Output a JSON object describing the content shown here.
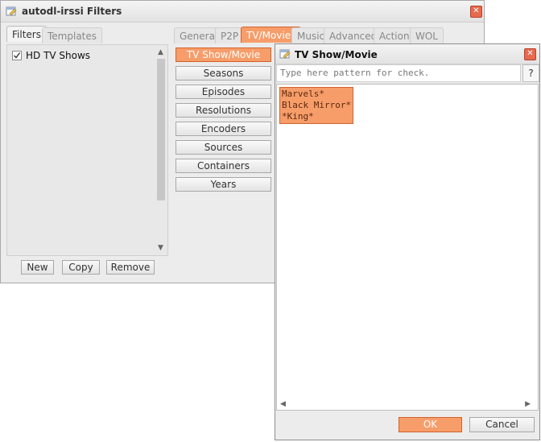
{
  "main_window": {
    "title": "autodl-irssi Filters",
    "close_glyph": "✕",
    "left_tabs": [
      "Filters",
      "Templates"
    ],
    "filters": [
      {
        "label": "HD TV Shows",
        "checked": true
      }
    ],
    "buttons": {
      "new": "New",
      "copy": "Copy",
      "remove": "Remove"
    },
    "right_tabs": [
      "General",
      "P2P",
      "TV/Movies",
      "Music",
      "Advanced",
      "Action",
      "WOL"
    ],
    "active_right_tab": "TV/Movies",
    "section_buttons": [
      "TV Show/Movie",
      "Seasons",
      "Episodes",
      "Resolutions",
      "Encoders",
      "Sources",
      "Containers",
      "Years"
    ],
    "active_section": "TV Show/Movie"
  },
  "dialog": {
    "title": "TV Show/Movie",
    "close_glyph": "✕",
    "pattern_placeholder": "Type here pattern for check.",
    "help_label": "?",
    "text_content": "Marvels*\nBlack Mirror*\n*King*",
    "ok_label": "OK",
    "cancel_label": "Cancel"
  },
  "colors": {
    "accent": "#f79d6a",
    "accent_border": "#d1622c",
    "close": "#e66b4e"
  },
  "icons": [
    "window-icon",
    "close-icon",
    "checkmark-icon",
    "scroll-up-icon",
    "scroll-down-icon",
    "scroll-left-icon",
    "scroll-right-icon",
    "dialog-icon"
  ]
}
